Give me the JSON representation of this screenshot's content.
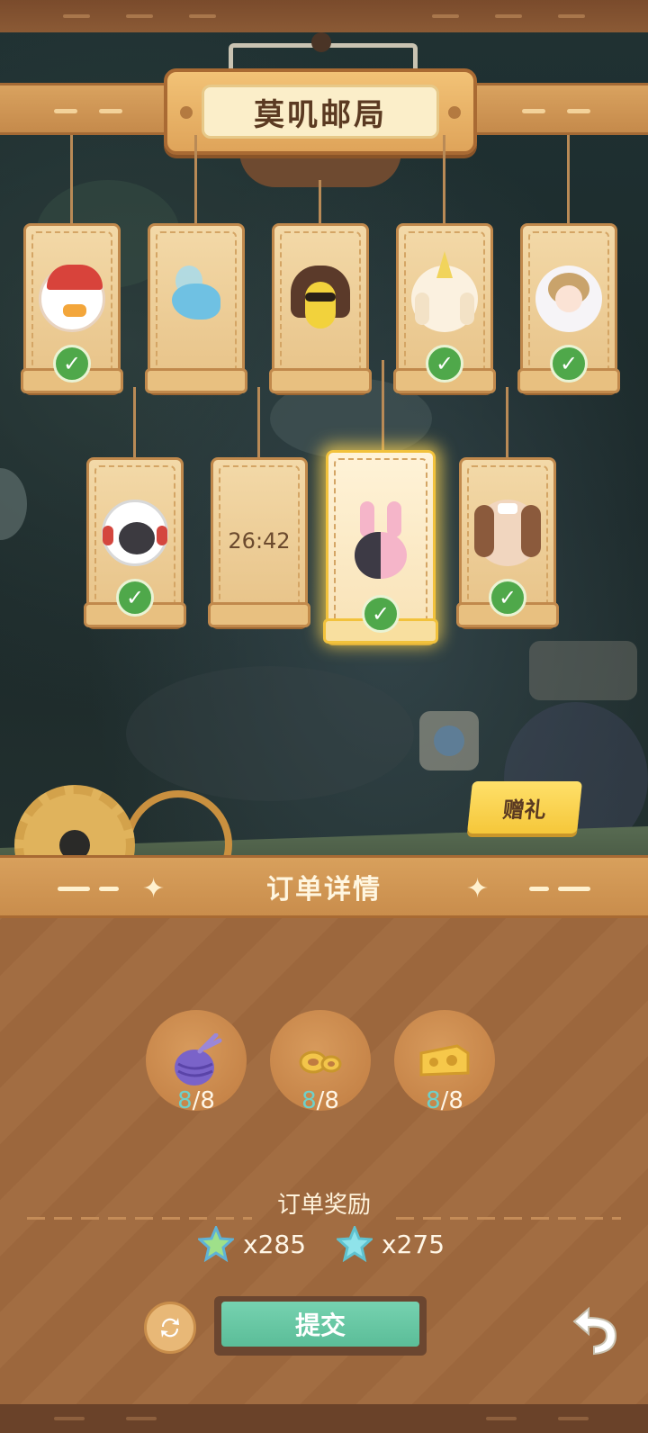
{
  "header": {
    "title": "莫叽邮局"
  },
  "orders": {
    "row1": [
      {
        "portrait": "duck-cap-portrait",
        "completed": true
      },
      {
        "portrait": "blue-bird-portrait",
        "completed": false
      },
      {
        "portrait": "banana-portrait",
        "completed": false
      },
      {
        "portrait": "party-bunny-portrait",
        "completed": true
      },
      {
        "portrait": "girl-portrait",
        "completed": true
      }
    ],
    "row2": [
      {
        "portrait": "gorilla-headphones-portrait",
        "completed": true
      },
      {
        "timer": "26:42"
      },
      {
        "portrait": "pink-rabbit-portrait",
        "completed": true,
        "selected": true
      },
      {
        "portrait": "dog-bow-portrait",
        "completed": true
      }
    ]
  },
  "gift_button": "赠礼",
  "details": {
    "title": "订单详情",
    "items": [
      {
        "icon": "purple-yarn-icon",
        "have": "8",
        "need": "/8"
      },
      {
        "icon": "gold-rings-icon",
        "have": "8",
        "need": "/8"
      },
      {
        "icon": "cheese-icon",
        "have": "8",
        "need": "/8"
      }
    ],
    "reward_title": "订单奖励",
    "rewards": [
      {
        "icon": "green-star-icon",
        "amount": "x285"
      },
      {
        "icon": "blue-star-icon",
        "amount": "x275"
      }
    ]
  },
  "actions": {
    "submit": "提交",
    "refresh_icon": "refresh-icon",
    "back_icon": "undo-arrow-icon"
  },
  "colors": {
    "accent_green": "#5bbd98",
    "check_green": "#4fa84a",
    "count_have": "#6fd0c9",
    "wood": "#a26d42",
    "gift_yellow": "#f5c73a"
  }
}
